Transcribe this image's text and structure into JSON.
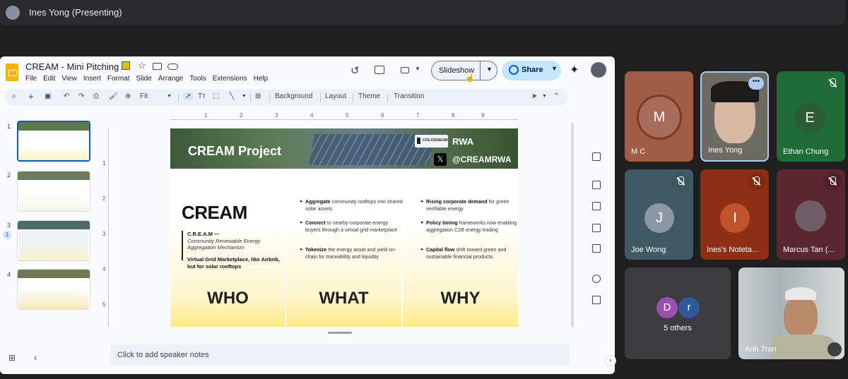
{
  "meeting": {
    "presenter_label": "Ines Yong (Presenting)"
  },
  "slides_app": {
    "doc_title": "CREAM - Mini Pitching",
    "menu": [
      "File",
      "Edit",
      "View",
      "Insert",
      "Format",
      "Slide",
      "Arrange",
      "Tools",
      "Extensions",
      "Help"
    ],
    "slideshow_label": "Slideshow",
    "share_label": "Share",
    "zoom": "Fit",
    "toolbar_actions": [
      "Background",
      "Layout",
      "Theme",
      "Transition"
    ],
    "ruler_ticks": [
      "1",
      "2",
      "3",
      "4",
      "5",
      "6",
      "7",
      "8",
      "9"
    ],
    "vruler_ticks": [
      "1",
      "2",
      "3",
      "4",
      "5"
    ],
    "slide_numbers": [
      "1",
      "2",
      "3",
      "4"
    ],
    "comment_badge": "1",
    "speaker_notes_placeholder": "Click to add speaker notes"
  },
  "slide": {
    "title": "CREAM Project",
    "colosseum": "COLOSSEUM",
    "rwa": "RWA",
    "handle": "@CREAMRWA",
    "brand": "CREAM",
    "acronym": "C.R.E.A.M —",
    "expansion": "Community Renewable Energy Aggregation Mechanism",
    "tagline": "Virtual Grid Marketplace, like Airbnb, but for solar rooftops",
    "who": "WHO",
    "what": "WHAT",
    "why": "WHY",
    "what_bullets": [
      {
        "bold": "Aggregate",
        "rest": " community rooftops into shared solar assets"
      },
      {
        "bold": "Connect",
        "rest": " to nearby corporate energy buyers through a virtual grid marketplace"
      },
      {
        "bold": "Tokenize",
        "rest": " the energy asset and yield on-chain for traceability and liquidity"
      }
    ],
    "why_bullets": [
      {
        "bold": "Rising corporate demand",
        "rest": " for green verifiable energy"
      },
      {
        "bold": "Policy timing",
        "rest": " frameworks now enabling aggregation C2B energy trading"
      },
      {
        "bold": "Capital flow",
        "rest": " shift toward green and sustainable financial products"
      }
    ]
  },
  "participants": [
    {
      "name": "M C",
      "initial": "M",
      "color": "#a15c45",
      "muted": false
    },
    {
      "name": "Ines Yong",
      "initial": "",
      "color": "#6c6a63",
      "muted": false
    },
    {
      "name": "Ethan Chung",
      "initial": "E",
      "color": "#1f6d36",
      "muted": true
    },
    {
      "name": "Joe Wong",
      "initial": "J",
      "color": "#8d98a5",
      "muted": true
    },
    {
      "name": "Ines's Noteta...",
      "initial": "I",
      "color": "#c0522e",
      "muted": true
    },
    {
      "name": "Marcus Tan (...",
      "initial": "",
      "color": "#6b2d34",
      "muted": true
    },
    {
      "name": "5 others",
      "initial": "",
      "color": "#3c3c3f",
      "muted": false
    },
    {
      "name": "Anh Tran",
      "initial": "",
      "color": "#7a8b86",
      "muted": false
    }
  ],
  "others_initials": [
    "D",
    "r"
  ]
}
